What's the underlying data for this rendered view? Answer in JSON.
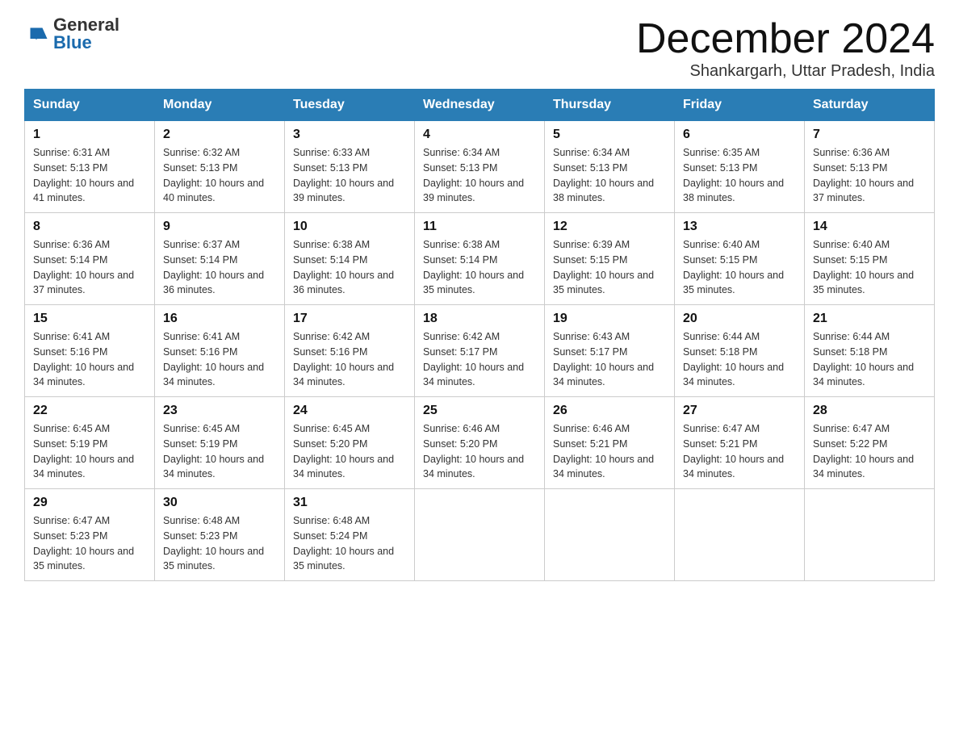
{
  "header": {
    "logo_general": "General",
    "logo_blue": "Blue",
    "month_title": "December 2024",
    "location": "Shankargarh, Uttar Pradesh, India"
  },
  "weekdays": [
    "Sunday",
    "Monday",
    "Tuesday",
    "Wednesday",
    "Thursday",
    "Friday",
    "Saturday"
  ],
  "weeks": [
    [
      {
        "day": "1",
        "sunrise": "6:31 AM",
        "sunset": "5:13 PM",
        "daylight": "10 hours and 41 minutes."
      },
      {
        "day": "2",
        "sunrise": "6:32 AM",
        "sunset": "5:13 PM",
        "daylight": "10 hours and 40 minutes."
      },
      {
        "day": "3",
        "sunrise": "6:33 AM",
        "sunset": "5:13 PM",
        "daylight": "10 hours and 39 minutes."
      },
      {
        "day": "4",
        "sunrise": "6:34 AM",
        "sunset": "5:13 PM",
        "daylight": "10 hours and 39 minutes."
      },
      {
        "day": "5",
        "sunrise": "6:34 AM",
        "sunset": "5:13 PM",
        "daylight": "10 hours and 38 minutes."
      },
      {
        "day": "6",
        "sunrise": "6:35 AM",
        "sunset": "5:13 PM",
        "daylight": "10 hours and 38 minutes."
      },
      {
        "day": "7",
        "sunrise": "6:36 AM",
        "sunset": "5:13 PM",
        "daylight": "10 hours and 37 minutes."
      }
    ],
    [
      {
        "day": "8",
        "sunrise": "6:36 AM",
        "sunset": "5:14 PM",
        "daylight": "10 hours and 37 minutes."
      },
      {
        "day": "9",
        "sunrise": "6:37 AM",
        "sunset": "5:14 PM",
        "daylight": "10 hours and 36 minutes."
      },
      {
        "day": "10",
        "sunrise": "6:38 AM",
        "sunset": "5:14 PM",
        "daylight": "10 hours and 36 minutes."
      },
      {
        "day": "11",
        "sunrise": "6:38 AM",
        "sunset": "5:14 PM",
        "daylight": "10 hours and 35 minutes."
      },
      {
        "day": "12",
        "sunrise": "6:39 AM",
        "sunset": "5:15 PM",
        "daylight": "10 hours and 35 minutes."
      },
      {
        "day": "13",
        "sunrise": "6:40 AM",
        "sunset": "5:15 PM",
        "daylight": "10 hours and 35 minutes."
      },
      {
        "day": "14",
        "sunrise": "6:40 AM",
        "sunset": "5:15 PM",
        "daylight": "10 hours and 35 minutes."
      }
    ],
    [
      {
        "day": "15",
        "sunrise": "6:41 AM",
        "sunset": "5:16 PM",
        "daylight": "10 hours and 34 minutes."
      },
      {
        "day": "16",
        "sunrise": "6:41 AM",
        "sunset": "5:16 PM",
        "daylight": "10 hours and 34 minutes."
      },
      {
        "day": "17",
        "sunrise": "6:42 AM",
        "sunset": "5:16 PM",
        "daylight": "10 hours and 34 minutes."
      },
      {
        "day": "18",
        "sunrise": "6:42 AM",
        "sunset": "5:17 PM",
        "daylight": "10 hours and 34 minutes."
      },
      {
        "day": "19",
        "sunrise": "6:43 AM",
        "sunset": "5:17 PM",
        "daylight": "10 hours and 34 minutes."
      },
      {
        "day": "20",
        "sunrise": "6:44 AM",
        "sunset": "5:18 PM",
        "daylight": "10 hours and 34 minutes."
      },
      {
        "day": "21",
        "sunrise": "6:44 AM",
        "sunset": "5:18 PM",
        "daylight": "10 hours and 34 minutes."
      }
    ],
    [
      {
        "day": "22",
        "sunrise": "6:45 AM",
        "sunset": "5:19 PM",
        "daylight": "10 hours and 34 minutes."
      },
      {
        "day": "23",
        "sunrise": "6:45 AM",
        "sunset": "5:19 PM",
        "daylight": "10 hours and 34 minutes."
      },
      {
        "day": "24",
        "sunrise": "6:45 AM",
        "sunset": "5:20 PM",
        "daylight": "10 hours and 34 minutes."
      },
      {
        "day": "25",
        "sunrise": "6:46 AM",
        "sunset": "5:20 PM",
        "daylight": "10 hours and 34 minutes."
      },
      {
        "day": "26",
        "sunrise": "6:46 AM",
        "sunset": "5:21 PM",
        "daylight": "10 hours and 34 minutes."
      },
      {
        "day": "27",
        "sunrise": "6:47 AM",
        "sunset": "5:21 PM",
        "daylight": "10 hours and 34 minutes."
      },
      {
        "day": "28",
        "sunrise": "6:47 AM",
        "sunset": "5:22 PM",
        "daylight": "10 hours and 34 minutes."
      }
    ],
    [
      {
        "day": "29",
        "sunrise": "6:47 AM",
        "sunset": "5:23 PM",
        "daylight": "10 hours and 35 minutes."
      },
      {
        "day": "30",
        "sunrise": "6:48 AM",
        "sunset": "5:23 PM",
        "daylight": "10 hours and 35 minutes."
      },
      {
        "day": "31",
        "sunrise": "6:48 AM",
        "sunset": "5:24 PM",
        "daylight": "10 hours and 35 minutes."
      },
      null,
      null,
      null,
      null
    ]
  ]
}
